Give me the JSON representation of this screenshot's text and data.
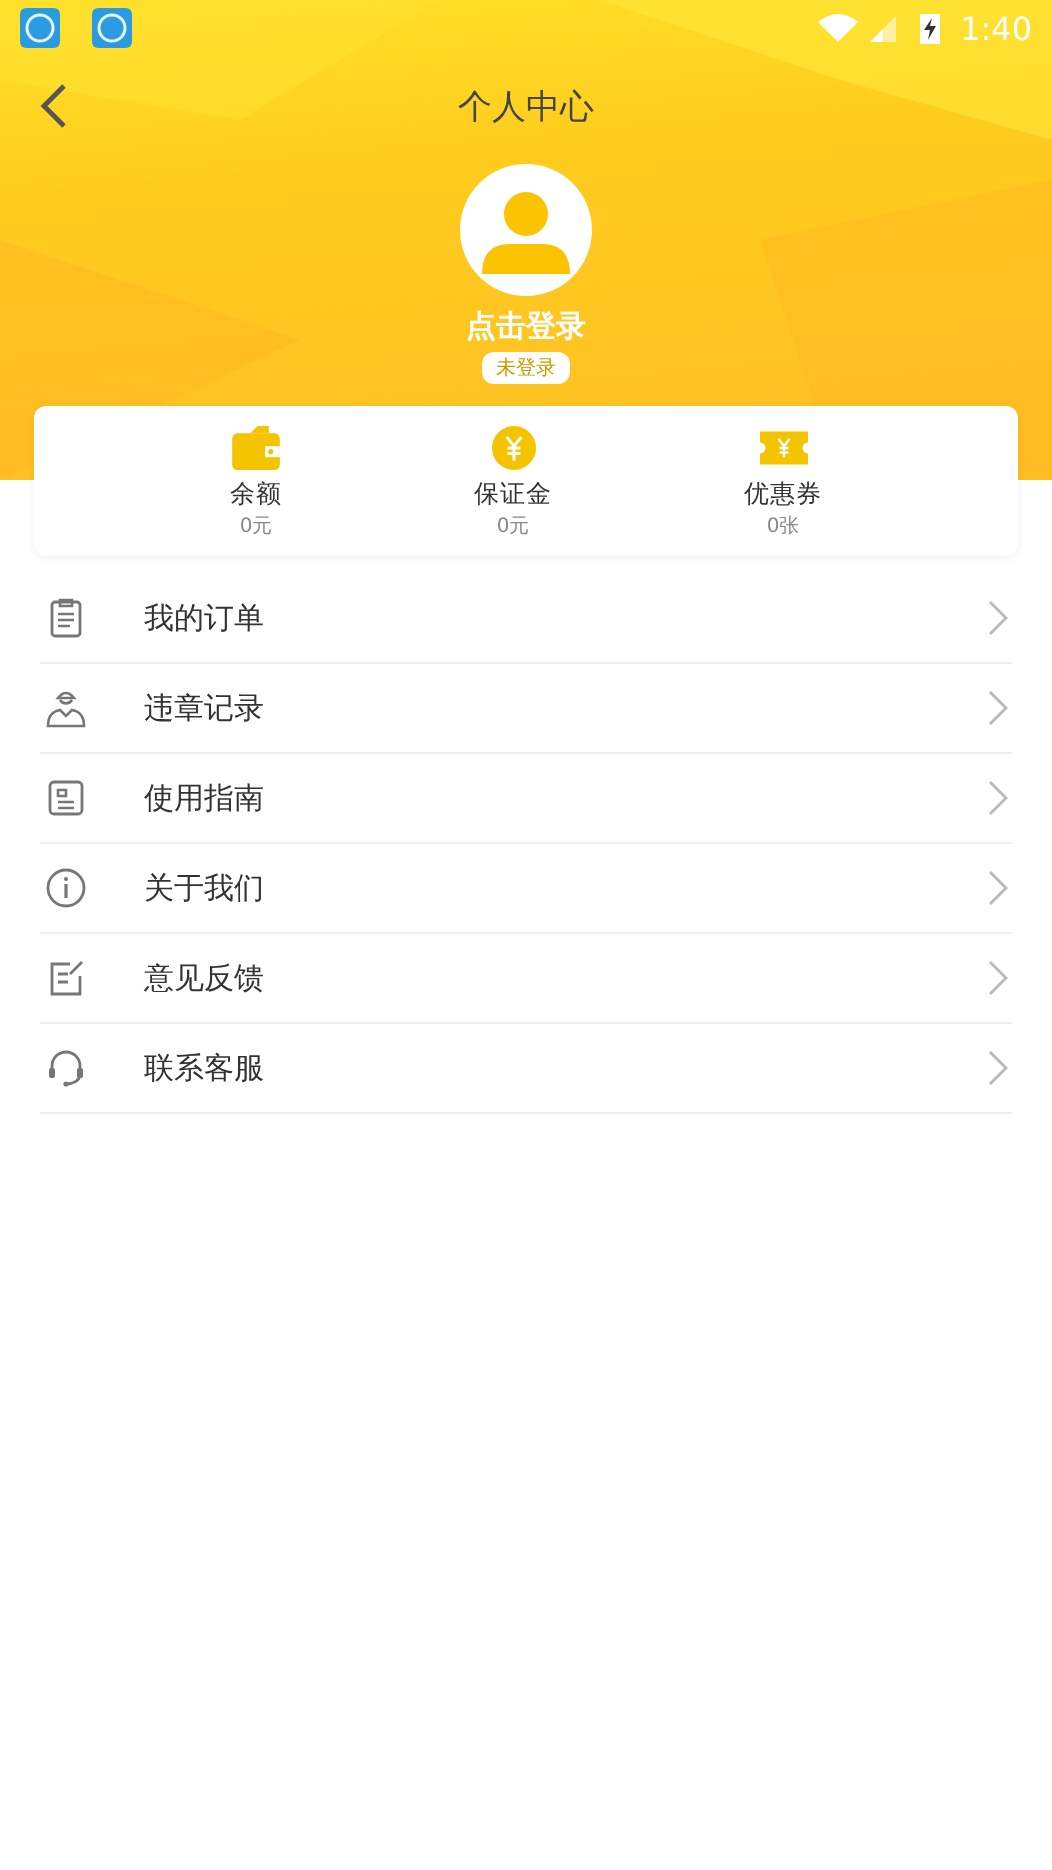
{
  "status_bar": {
    "time": "1:40"
  },
  "header": {
    "title": "个人中心",
    "login_label": "点击登录",
    "status_badge": "未登录"
  },
  "stats": [
    {
      "label": "余额",
      "value": "0元"
    },
    {
      "label": "保证金",
      "value": "0元"
    },
    {
      "label": "优惠券",
      "value": "0张"
    }
  ],
  "menu": [
    {
      "label": "我的订单"
    },
    {
      "label": "违章记录"
    },
    {
      "label": "使用指南"
    },
    {
      "label": "关于我们"
    },
    {
      "label": "意见反馈"
    },
    {
      "label": "联系客服"
    }
  ]
}
